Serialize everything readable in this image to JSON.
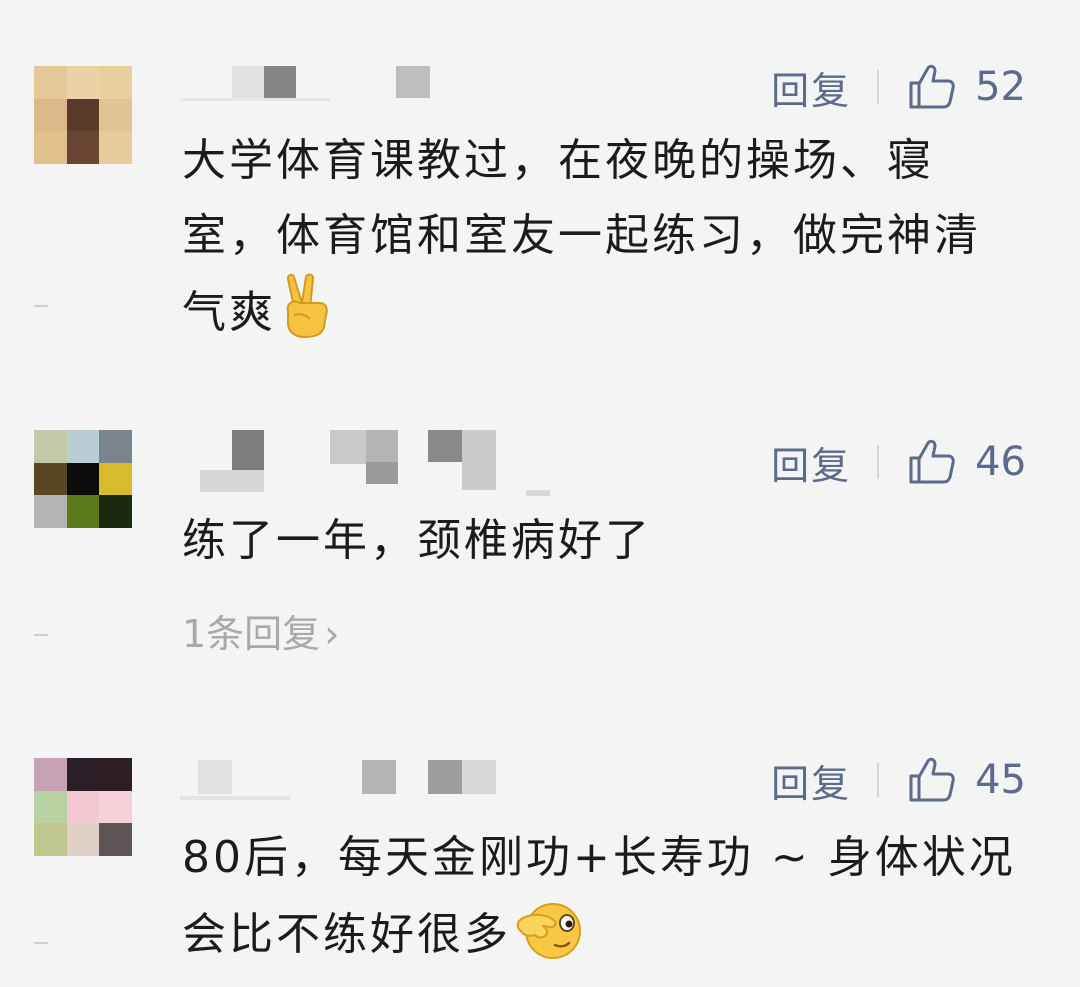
{
  "comments": [
    {
      "reply_label": "回复",
      "likes": "52",
      "text": "大学体育课教过，在夜晚的操场、寝室，体育馆和室友一起练习，做完神清气爽",
      "emoji": "victory-hand-emoji"
    },
    {
      "reply_label": "回复",
      "likes": "46",
      "text": "练了一年，颈椎病好了",
      "more_replies": "1条回复",
      "more_replies_chevron": "›"
    },
    {
      "reply_label": "回复",
      "likes": "45",
      "text": "80后，每天金刚功+长寿功 ~ 身体状况会比不练好很多",
      "emoji": "peek-face-emoji"
    }
  ],
  "colors": {
    "background": "#f4f4f4",
    "action_blue": "#5c6b8a",
    "muted_gray": "#a9a9a9"
  }
}
